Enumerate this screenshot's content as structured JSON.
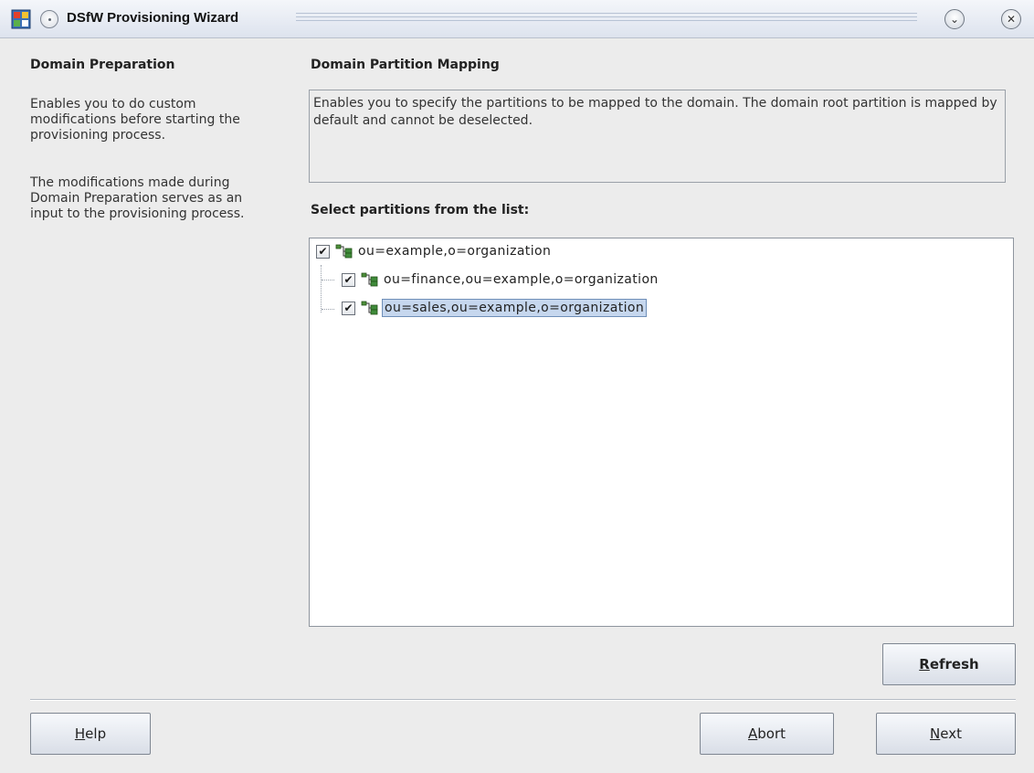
{
  "window": {
    "title": "DSfW Provisioning Wizard"
  },
  "left_panel": {
    "heading": "Domain Preparation",
    "paragraph1": "Enables you to do custom modifications before starting the provisioning process.",
    "paragraph2": "The modifications made during Domain Preparation serves as an input to the provisioning process."
  },
  "main": {
    "heading": "Domain Partition Mapping",
    "description": "Enables you to specify the partitions to be mapped to the domain. The domain root partition is mapped by default and cannot be deselected.",
    "list_label": "Select partitions from the list:",
    "partitions": [
      {
        "label": "ou=example,o=organization",
        "checked": true,
        "selected": false
      },
      {
        "label": "ou=finance,ou=example,o=organization",
        "checked": true,
        "selected": false
      },
      {
        "label": "ou=sales,ou=example,o=organization",
        "checked": true,
        "selected": true
      }
    ],
    "check_mark": "✔"
  },
  "buttons": {
    "refresh": {
      "mnemonic": "R",
      "rest": "efresh"
    },
    "help": {
      "mnemonic": "H",
      "rest": "elp"
    },
    "abort": {
      "mnemonic": "A",
      "rest": "bort"
    },
    "next": {
      "mnemonic": "N",
      "rest": "ext"
    }
  },
  "icons": {
    "app": "wizard-app-icon",
    "tree_node": "partition-tree-icon",
    "minimize": "chevron-down-icon",
    "close": "close-icon"
  }
}
